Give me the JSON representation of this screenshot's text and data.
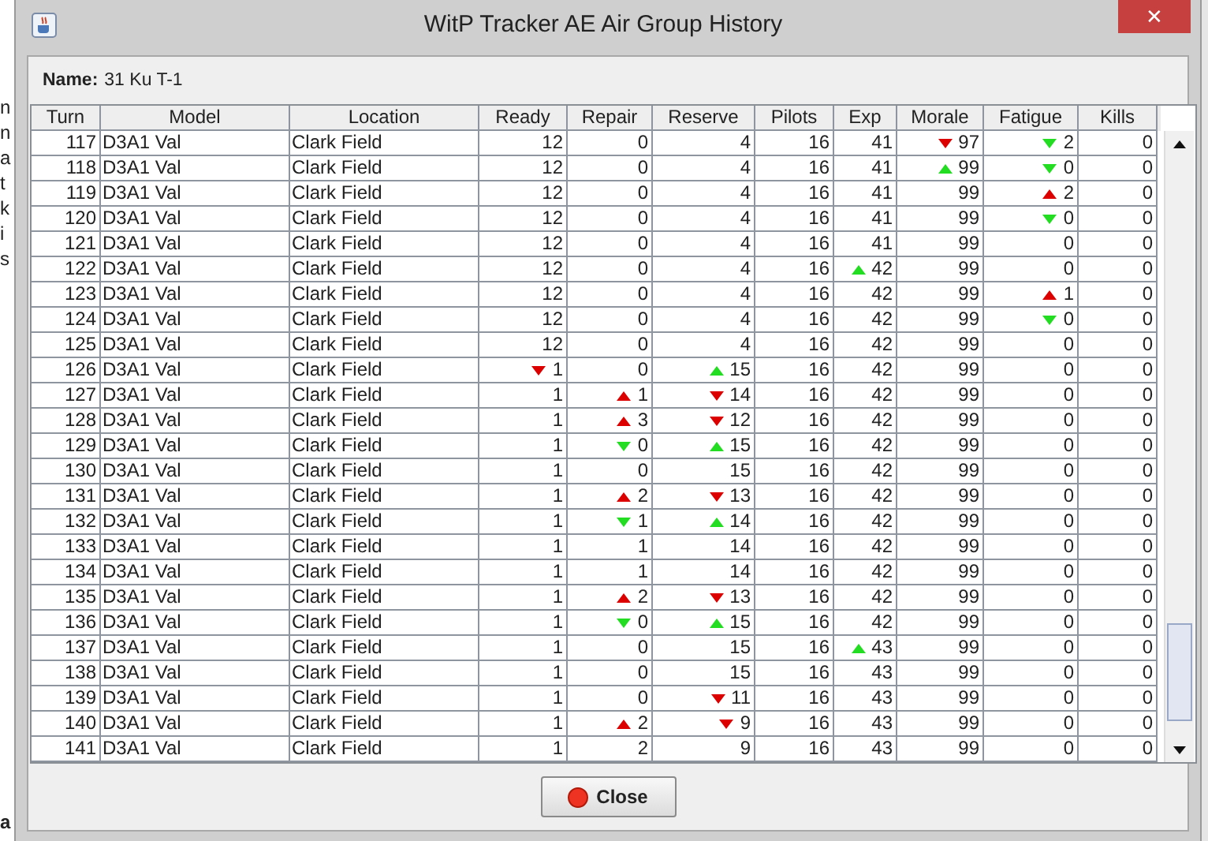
{
  "background_fragments": [
    "n",
    "n",
    "a",
    "t",
    "k",
    "i",
    "s"
  ],
  "background_bottom": "a",
  "window": {
    "title": "WitP Tracker AE Air Group History",
    "close": "✕"
  },
  "name_label": "Name:",
  "name_value": "31 Ku T-1",
  "table": {
    "columns": [
      "Turn",
      "Model",
      "Location",
      "Ready",
      "Repair",
      "Reserve",
      "Pilots",
      "Exp",
      "Morale",
      "Fatigue",
      "Kills"
    ],
    "rows": [
      [
        "117",
        "D3A1 Val",
        "Clark Field",
        "12",
        "0",
        "4",
        "16",
        "41",
        {
          "text": "97",
          "up": false,
          "good": false
        },
        {
          "text": "2",
          "up": false,
          "good": true
        },
        "0"
      ],
      [
        "118",
        "D3A1 Val",
        "Clark Field",
        "12",
        "0",
        "4",
        "16",
        "41",
        {
          "text": "99",
          "up": true,
          "good": true
        },
        {
          "text": "0",
          "up": false,
          "good": true
        },
        "0"
      ],
      [
        "119",
        "D3A1 Val",
        "Clark Field",
        "12",
        "0",
        "4",
        "16",
        "41",
        "99",
        {
          "text": "2",
          "up": true,
          "good": false
        },
        "0"
      ],
      [
        "120",
        "D3A1 Val",
        "Clark Field",
        "12",
        "0",
        "4",
        "16",
        "41",
        "99",
        {
          "text": "0",
          "up": false,
          "good": true
        },
        "0"
      ],
      [
        "121",
        "D3A1 Val",
        "Clark Field",
        "12",
        "0",
        "4",
        "16",
        "41",
        "99",
        "0",
        "0"
      ],
      [
        "122",
        "D3A1 Val",
        "Clark Field",
        "12",
        "0",
        "4",
        "16",
        {
          "text": "42",
          "up": true,
          "good": true
        },
        "99",
        "0",
        "0"
      ],
      [
        "123",
        "D3A1 Val",
        "Clark Field",
        "12",
        "0",
        "4",
        "16",
        "42",
        "99",
        {
          "text": "1",
          "up": true,
          "good": false
        },
        "0"
      ],
      [
        "124",
        "D3A1 Val",
        "Clark Field",
        "12",
        "0",
        "4",
        "16",
        "42",
        "99",
        {
          "text": "0",
          "up": false,
          "good": true
        },
        "0"
      ],
      [
        "125",
        "D3A1 Val",
        "Clark Field",
        "12",
        "0",
        "4",
        "16",
        "42",
        "99",
        "0",
        "0"
      ],
      [
        "126",
        "D3A1 Val",
        "Clark Field",
        {
          "text": "1",
          "up": false,
          "good": false
        },
        "0",
        {
          "text": "15",
          "up": true,
          "good": true
        },
        "16",
        "42",
        "99",
        "0",
        "0"
      ],
      [
        "127",
        "D3A1 Val",
        "Clark Field",
        "1",
        {
          "text": "1",
          "up": true,
          "good": false
        },
        {
          "text": "14",
          "up": false,
          "good": false
        },
        "16",
        "42",
        "99",
        "0",
        "0"
      ],
      [
        "128",
        "D3A1 Val",
        "Clark Field",
        "1",
        {
          "text": "3",
          "up": true,
          "good": false
        },
        {
          "text": "12",
          "up": false,
          "good": false
        },
        "16",
        "42",
        "99",
        "0",
        "0"
      ],
      [
        "129",
        "D3A1 Val",
        "Clark Field",
        "1",
        {
          "text": "0",
          "up": false,
          "good": true
        },
        {
          "text": "15",
          "up": true,
          "good": true
        },
        "16",
        "42",
        "99",
        "0",
        "0"
      ],
      [
        "130",
        "D3A1 Val",
        "Clark Field",
        "1",
        "0",
        "15",
        "16",
        "42",
        "99",
        "0",
        "0"
      ],
      [
        "131",
        "D3A1 Val",
        "Clark Field",
        "1",
        {
          "text": "2",
          "up": true,
          "good": false
        },
        {
          "text": "13",
          "up": false,
          "good": false
        },
        "16",
        "42",
        "99",
        "0",
        "0"
      ],
      [
        "132",
        "D3A1 Val",
        "Clark Field",
        "1",
        {
          "text": "1",
          "up": false,
          "good": true
        },
        {
          "text": "14",
          "up": true,
          "good": true
        },
        "16",
        "42",
        "99",
        "0",
        "0"
      ],
      [
        "133",
        "D3A1 Val",
        "Clark Field",
        "1",
        "1",
        "14",
        "16",
        "42",
        "99",
        "0",
        "0"
      ],
      [
        "134",
        "D3A1 Val",
        "Clark Field",
        "1",
        "1",
        "14",
        "16",
        "42",
        "99",
        "0",
        "0"
      ],
      [
        "135",
        "D3A1 Val",
        "Clark Field",
        "1",
        {
          "text": "2",
          "up": true,
          "good": false
        },
        {
          "text": "13",
          "up": false,
          "good": false
        },
        "16",
        "42",
        "99",
        "0",
        "0"
      ],
      [
        "136",
        "D3A1 Val",
        "Clark Field",
        "1",
        {
          "text": "0",
          "up": false,
          "good": true
        },
        {
          "text": "15",
          "up": true,
          "good": true
        },
        "16",
        "42",
        "99",
        "0",
        "0"
      ],
      [
        "137",
        "D3A1 Val",
        "Clark Field",
        "1",
        "0",
        "15",
        "16",
        {
          "text": "43",
          "up": true,
          "good": true
        },
        "99",
        "0",
        "0"
      ],
      [
        "138",
        "D3A1 Val",
        "Clark Field",
        "1",
        "0",
        "15",
        "16",
        "43",
        "99",
        "0",
        "0"
      ],
      [
        "139",
        "D3A1 Val",
        "Clark Field",
        "1",
        "0",
        {
          "text": "11",
          "up": false,
          "good": false
        },
        "16",
        "43",
        "99",
        "0",
        "0"
      ],
      [
        "140",
        "D3A1 Val",
        "Clark Field",
        "1",
        {
          "text": "2",
          "up": true,
          "good": false
        },
        {
          "text": "9",
          "up": false,
          "good": false
        },
        "16",
        "43",
        "99",
        "0",
        "0"
      ],
      [
        "141",
        "D3A1 Val",
        "Clark Field",
        "1",
        "2",
        "9",
        "16",
        "43",
        "99",
        "0",
        "0"
      ]
    ]
  },
  "buttons": [
    {
      "label": "Close"
    }
  ]
}
